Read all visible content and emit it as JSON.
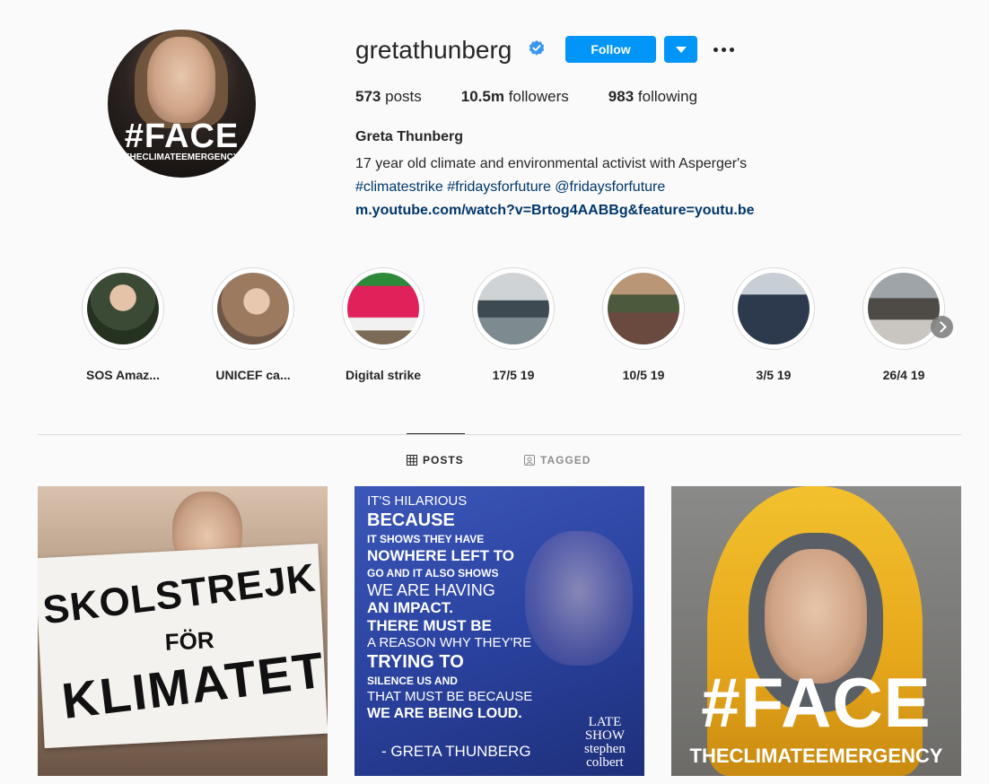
{
  "profile": {
    "username": "gretathunberg",
    "verified_icon": "verified-badge-icon",
    "follow_label": "Follow",
    "avatar_text_big": "#FACE",
    "avatar_text_small": "THECLIMATEEMERGENCY",
    "stats": {
      "posts_count": "573",
      "posts_label": "posts",
      "followers_count": "10.5m",
      "followers_label": "followers",
      "following_count": "983",
      "following_label": "following"
    },
    "full_name": "Greta Thunberg",
    "bio_line": "17 year old climate and environmental activist with Asperger's",
    "bio_tags": "#climatestrike #fridaysforfuture @fridaysforfuture",
    "bio_link": "m.youtube.com/watch?v=Brtog4AABBg&feature=youtu.be"
  },
  "highlights": [
    {
      "label": "SOS Amaz..."
    },
    {
      "label": "UNICEF ca..."
    },
    {
      "label": "Digital strike"
    },
    {
      "label": "17/5 19"
    },
    {
      "label": "10/5 19"
    },
    {
      "label": "3/5 19"
    },
    {
      "label": "26/4 19"
    }
  ],
  "tabs": {
    "posts": "POSTS",
    "tagged": "TAGGED"
  },
  "posts": {
    "post1": {
      "line1": "SKOLSTREJK",
      "line2": "FÖR",
      "line3": "KLIMATET"
    },
    "post2": {
      "lines": [
        "IT'S HILARIOUS",
        "BECAUSE",
        "IT SHOWS THEY HAVE",
        "NOWHERE LEFT TO",
        "GO AND IT ALSO SHOWS",
        "WE ARE HAVING",
        "AN IMPACT.",
        "THERE MUST BE",
        "A REASON WHY THEY'RE",
        "TRYING TO",
        "SILENCE US AND",
        "THAT MUST BE BECAUSE",
        "WE ARE BEING LOUD."
      ],
      "author": "- GRETA THUNBERG",
      "logo_l1": "LATE",
      "logo_l2": "SHOW",
      "logo_l3": "stephen",
      "logo_l4": "colbert"
    },
    "post3": {
      "big": "#FACE",
      "small": "THECLIMATEEMERGENCY"
    }
  },
  "colors": {
    "accent": "#0095f6",
    "link": "#00376b",
    "background": "#fafafa"
  }
}
